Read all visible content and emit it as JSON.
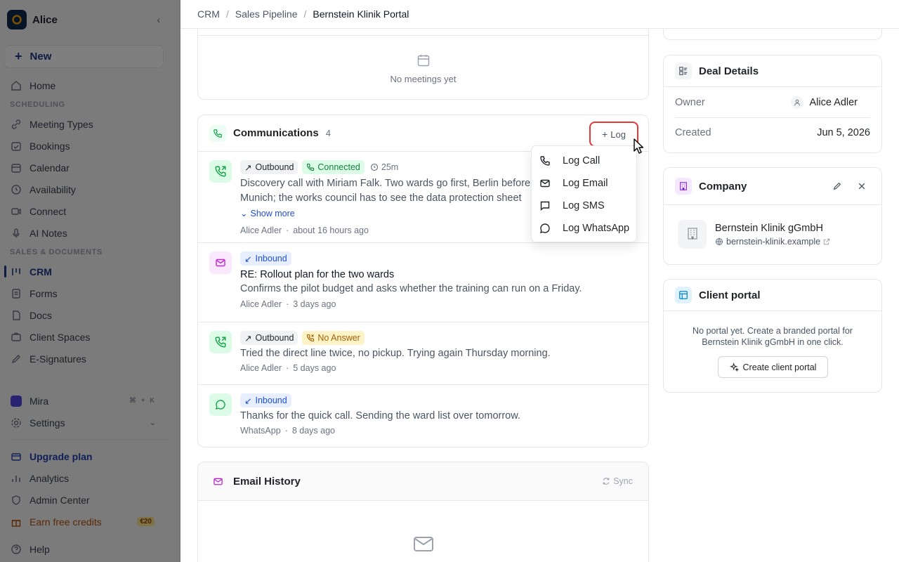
{
  "workspace": {
    "name": "Alice"
  },
  "sidebar": {
    "new_label": "New",
    "items": [
      {
        "label": "Home"
      },
      {
        "section": "SCHEDULING"
      },
      {
        "label": "Meeting Types"
      },
      {
        "label": "Bookings"
      },
      {
        "label": "Calendar"
      },
      {
        "label": "Availability"
      },
      {
        "label": "Connect"
      },
      {
        "label": "AI Notes"
      },
      {
        "section": "SALES & DOCUMENTS"
      },
      {
        "label": "CRM"
      },
      {
        "label": "Forms"
      },
      {
        "label": "Docs"
      },
      {
        "label": "Client Spaces"
      },
      {
        "label": "E-Signatures"
      }
    ],
    "mira": {
      "label": "Mira",
      "shortcut": "⌘ + K"
    },
    "settings": "Settings",
    "upgrade": "Upgrade plan",
    "analytics": "Analytics",
    "admin": "Admin Center",
    "earn": {
      "label": "Earn free credits",
      "badge": "€20"
    },
    "help": "Help"
  },
  "breadcrumb": {
    "crm": "CRM",
    "pipeline": "Sales Pipeline",
    "current": "Bernstein Klinik Portal"
  },
  "meetings": {
    "empty": "No meetings yet"
  },
  "communications": {
    "title": "Communications",
    "count": "4",
    "log_label": "Log",
    "items": [
      {
        "direction": "Outbound",
        "status": "Connected",
        "duration": "25m",
        "text": "Discovery call with Miriam Falk. Two wards go first, Berlin before Munich; the works council has to see the data protection sheet before any rollout.",
        "show_more": "Show more",
        "author": "Alice Adler",
        "time": "about 16 hours ago"
      },
      {
        "direction": "Inbound",
        "subject": "RE: Rollout plan for the two wards",
        "text": "Confirms the pilot budget and asks whether the training can run on a Friday.",
        "author": "Alice Adler",
        "time": "3 days ago"
      },
      {
        "direction": "Outbound",
        "status": "No Answer",
        "text": "Tried the direct line twice, no pickup. Trying again Thursday morning.",
        "author": "Alice Adler",
        "time": "5 days ago"
      },
      {
        "direction": "Inbound",
        "text": "Thanks for the quick call. Sending the ward list over tomorrow.",
        "author": "WhatsApp",
        "time": "8 days ago"
      }
    ]
  },
  "log_menu": {
    "call": "Log Call",
    "email": "Log Email",
    "sms": "Log SMS",
    "whatsapp": "Log WhatsApp"
  },
  "email_history": {
    "title": "Email History",
    "sync": "Sync"
  },
  "deal_details": {
    "title": "Deal Details",
    "owner_label": "Owner",
    "owner": "Alice Adler",
    "created_label": "Created",
    "created": "Jun 5, 2026"
  },
  "company": {
    "title": "Company",
    "name": "Bernstein Klinik gGmbH",
    "url": "bernstein-klinik.example"
  },
  "client_portal": {
    "title": "Client portal",
    "text": "No portal yet. Create a branded portal for Bernstein Klinik gGmbH in one click.",
    "button": "Create client portal"
  },
  "colors": {
    "accent": "#1e3a8a",
    "highlight_border": "#e53935",
    "call_green": "#16a34a",
    "email_purple": "#c026d3"
  }
}
